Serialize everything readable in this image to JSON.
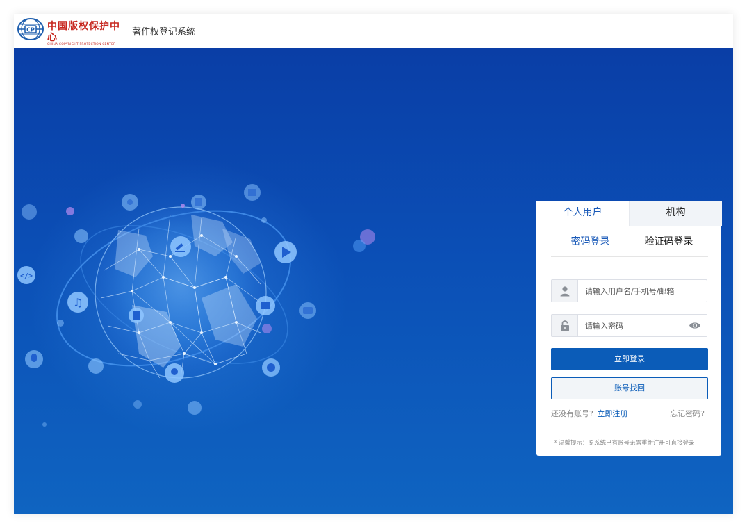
{
  "header": {
    "logo_cn": "中国版权保护中心",
    "logo_en": "CHINA COPYRIGHT PROTECTION CENTER",
    "system_title": "著作权登记系统"
  },
  "login": {
    "user_tabs": [
      "个人用户",
      "机构"
    ],
    "active_user_tab": "个人用户",
    "login_tabs": [
      "密码登录",
      "验证码登录"
    ],
    "active_login_tab": "密码登录",
    "username_placeholder": "请输入用户名/手机号/邮箱",
    "password_placeholder": "请输入密码",
    "login_button": "立即登录",
    "recover_button": "账号找回",
    "no_account_text": "还没有账号?",
    "register_link": "立即注册",
    "forgot_link": "忘记密码?",
    "tip": "* 温馨提示：原系统已有账号无需重新注册可直接登录"
  },
  "colors": {
    "brand_red": "#c7271f",
    "primary_blue": "#0b5cb8",
    "banner_top": "#0a3ea6",
    "banner_bottom": "#0f64c1"
  },
  "icons": {
    "user_field": "user-icon",
    "password_field": "lock-icon",
    "password_toggle": "eye-icon"
  }
}
